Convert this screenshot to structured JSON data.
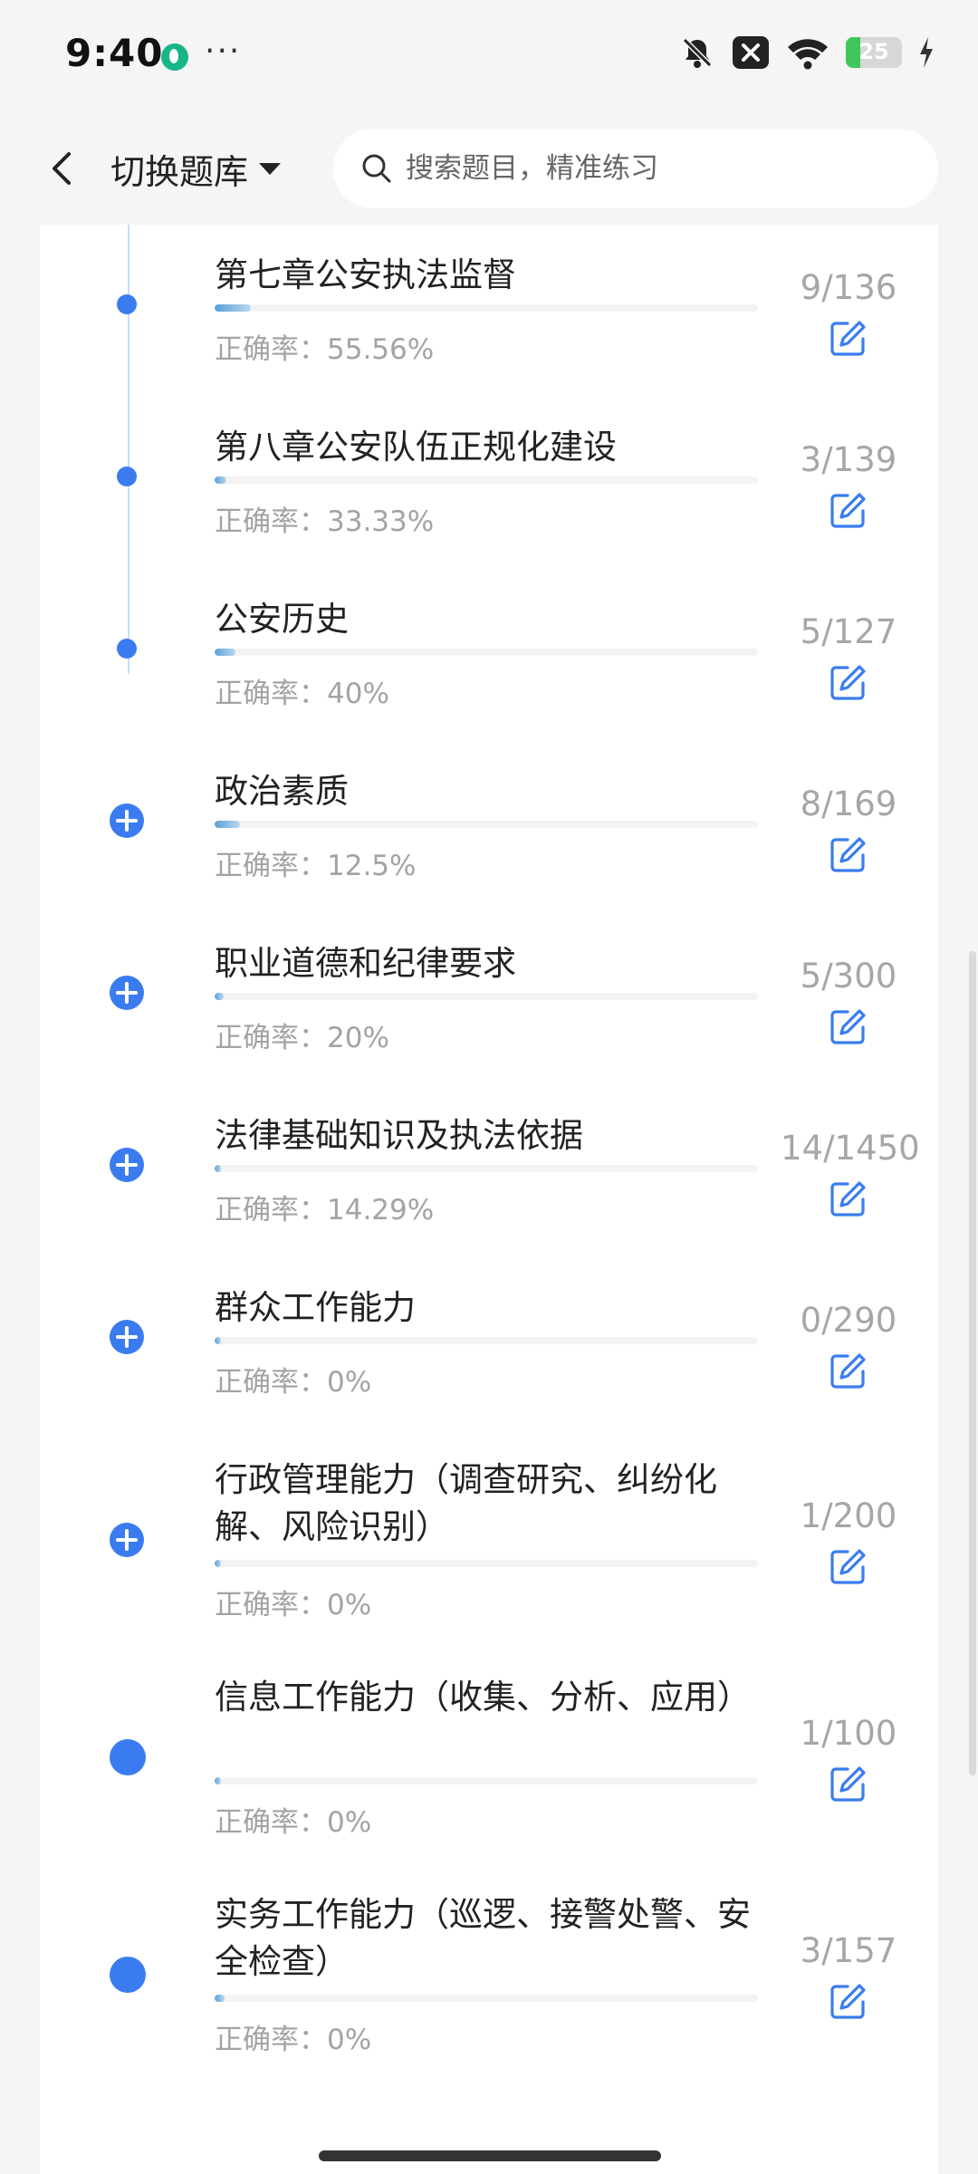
{
  "status_bar": {
    "time": "9:40",
    "app_icon": "green-app-icon",
    "more_label": "···",
    "icons": [
      "bell-off-icon",
      "close-box-icon",
      "wifi-icon",
      "battery-icon",
      "charging-icon"
    ],
    "battery_level": "25",
    "battery_fill_percent": 25,
    "battery_color": "#3ec75a"
  },
  "header": {
    "back_icon": "chevron-left-icon",
    "switch_label": "切换题库",
    "dropdown_icon": "caret-down-icon",
    "search_placeholder": "搜索题目，精准练习",
    "search_value": ""
  },
  "theme": {
    "accent": "#3a7cf0",
    "count_color": "#a6a6a6"
  },
  "items": [
    {
      "title": "第七章公安执法监督",
      "accuracy": "正确率：55.56%",
      "count": "9/136",
      "progress_fraction": 0.066,
      "node": "dot"
    },
    {
      "title": "第八章公安队伍正规化建设",
      "accuracy": "正确率：33.33%",
      "count": "3/139",
      "progress_fraction": 0.022,
      "node": "dot"
    },
    {
      "title": "公安历史",
      "accuracy": "正确率：40%",
      "count": "5/127",
      "progress_fraction": 0.039,
      "node": "dot"
    },
    {
      "title": "政治素质",
      "accuracy": "正确率：12.5%",
      "count": "8/169",
      "progress_fraction": 0.047,
      "node": "plus"
    },
    {
      "title": "职业道德和纪律要求",
      "accuracy": "正确率：20%",
      "count": "5/300",
      "progress_fraction": 0.017,
      "node": "plus"
    },
    {
      "title": "法律基础知识及执法依据",
      "accuracy": "正确率：14.29%",
      "count": "14/1450",
      "progress_fraction": 0.0097,
      "node": "plus"
    },
    {
      "title": "群众工作能力",
      "accuracy": "正确率：0%",
      "count": "0/290",
      "progress_fraction": 0,
      "node": "plus"
    },
    {
      "title": "行政管理能力（调查研究、纠纷化解、风险识别）",
      "accuracy": "正确率：0%",
      "count": "1/200",
      "progress_fraction": 0.005,
      "node": "plus"
    },
    {
      "title": "信息工作能力（收集、分析、应用）",
      "accuracy": "正确率：0%",
      "count": "1/100",
      "progress_fraction": 0.01,
      "node": "big-dot"
    },
    {
      "title": "实务工作能力（巡逻、接警处警、安全检查）",
      "accuracy": "正确率：0%",
      "count": "3/157",
      "progress_fraction": 0.019,
      "node": "big-dot"
    }
  ],
  "item_icons": {
    "edit_icon": "edit-icon",
    "expand_icon": "plus-circle-icon"
  }
}
